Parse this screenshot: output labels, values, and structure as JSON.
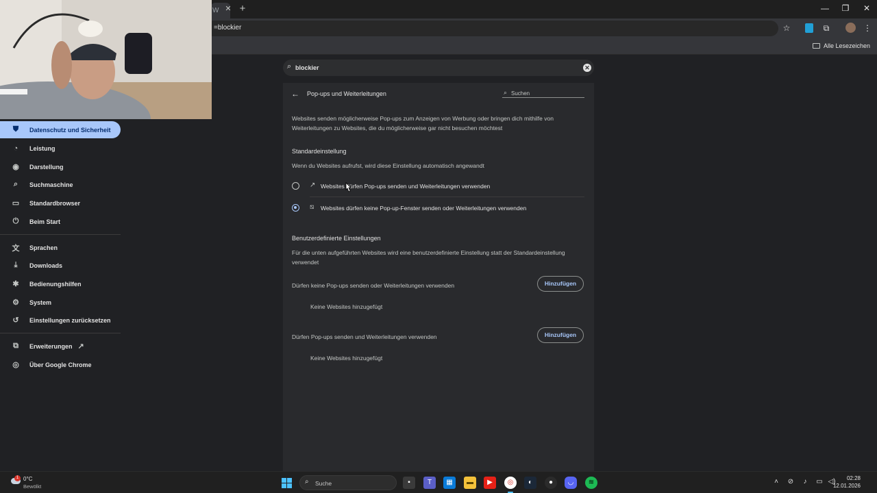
{
  "browser": {
    "tab_fragment": "W",
    "url_fragment": "=blockier",
    "bookmarks_all_label": "Alle Lesezeichen"
  },
  "settings_search": {
    "value": "blockier"
  },
  "sidebar": {
    "items": [
      {
        "label": "Datenschutz und Sicherheit",
        "icon": "shield-icon",
        "active": true
      },
      {
        "label": "Leistung",
        "icon": "speedometer-icon"
      },
      {
        "label": "Darstellung",
        "icon": "palette-icon"
      },
      {
        "label": "Suchmaschine",
        "icon": "search-icon"
      },
      {
        "label": "Standardbrowser",
        "icon": "browser-window-icon"
      },
      {
        "label": "Beim Start",
        "icon": "power-icon"
      },
      {
        "label": "Sprachen",
        "icon": "translate-icon"
      },
      {
        "label": "Downloads",
        "icon": "download-icon"
      },
      {
        "label": "Bedienungshilfen",
        "icon": "accessibility-icon"
      },
      {
        "label": "System",
        "icon": "wrench-icon"
      },
      {
        "label": "Einstellungen zurücksetzen",
        "icon": "reset-icon"
      },
      {
        "label": "Erweiterungen",
        "icon": "puzzle-icon"
      },
      {
        "label": "Über Google Chrome",
        "icon": "chrome-icon"
      }
    ]
  },
  "page": {
    "title": "Pop-ups und Weiterleitungen",
    "search_placeholder": "Suchen",
    "description": "Websites senden möglicherweise Pop-ups zum Anzeigen von Werbung oder bringen dich mithilfe von Weiterleitungen zu Websites, die du möglicherweise gar nicht besuchen möchtest",
    "default_heading": "Standardeinstellung",
    "default_subtitle": "Wenn du Websites aufrufst, wird diese Einstellung automatisch angewandt",
    "options": [
      {
        "label": "Websites dürfen Pop-ups senden und Weiterleitungen verwenden",
        "icon": "open-in-new-icon",
        "checked": false
      },
      {
        "label": "Websites dürfen keine Pop-up-Fenster senden oder Weiterleitungen verwenden",
        "icon": "popup-blocked-icon",
        "checked": true
      }
    ],
    "custom_heading": "Benutzerdefinierte Einstellungen",
    "custom_subtitle": "Für die unten aufgeführten Websites wird eine benutzerdefinierte Einstellung statt der Standardeinstellung verwendet",
    "block_list": {
      "label": "Dürfen keine Pop-ups senden oder Weiterleitungen verwenden",
      "button": "Hinzufügen",
      "empty": "Keine Websites hinzugefügt"
    },
    "allow_list": {
      "label": "Dürfen Pop-ups senden und Weiterleitungen verwenden",
      "button": "Hinzufügen",
      "empty": "Keine Websites hinzugefügt"
    }
  },
  "taskbar": {
    "weather_badge": "1",
    "temperature": "0°C",
    "condition": "Bewölkt",
    "search_placeholder": "Suche",
    "time": "02:28",
    "date": "12.01.2026"
  },
  "colors": {
    "accent": "#a8c7fa",
    "background": "#202124",
    "card": "#292a2d"
  }
}
